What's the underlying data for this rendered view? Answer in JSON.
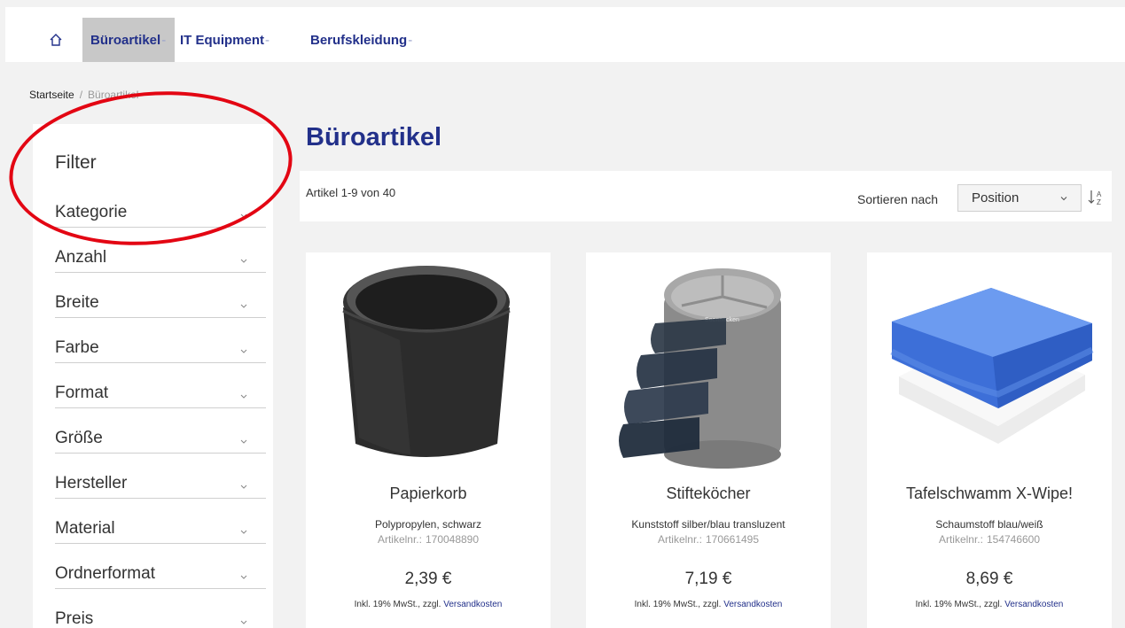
{
  "nav": {
    "home_icon": "home-icon",
    "items": [
      {
        "label": "Büroartikel",
        "dash": "-",
        "active": true
      },
      {
        "label": "IT Equipment",
        "dash": "-"
      },
      {
        "label": "Berufskleidung",
        "dash": "-"
      }
    ]
  },
  "breadcrumb": {
    "home": "Startseite",
    "separator": "/",
    "current": "Büroartikel"
  },
  "filter": {
    "title": "Filter",
    "items": [
      "Kategorie",
      "Anzahl",
      "Breite",
      "Farbe",
      "Format",
      "Größe",
      "Hersteller",
      "Material",
      "Ordnerformat",
      "Preis"
    ]
  },
  "page": {
    "title": "Büroartikel"
  },
  "toolbar": {
    "count": "Artikel 1-9 von 40",
    "sort_label": "Sortieren nach",
    "sort_value": "Position",
    "sort_direction_icon": "sort-ascending-icon"
  },
  "products": [
    {
      "name": "Papierkorb",
      "desc": "Polypropylen, schwarz",
      "sku_label": "Artikelnr.:",
      "sku": "170048890",
      "price": "2,39 €",
      "tax": "Inkl. 19% MwSt., zzgl.",
      "shipping_link": "Versandkosten"
    },
    {
      "name": "Stifteköcher",
      "desc": "Kunststoff silber/blau transluzent",
      "sku_label": "Artikelnr.:",
      "sku": "170661495",
      "price": "7,19 €",
      "tax": "Inkl. 19% MwSt., zzgl.",
      "shipping_link": "Versandkosten",
      "image_brand": "Soennecken"
    },
    {
      "name": "Tafelschwamm X-Wipe!",
      "desc": "Schaumstoff blau/weiß",
      "sku_label": "Artikelnr.:",
      "sku": "154746600",
      "price": "8,69 €",
      "tax": "Inkl. 19% MwSt., zzgl.",
      "shipping_link": "Versandkosten"
    }
  ],
  "colors": {
    "brand": "#22308a",
    "annotation": "#e30613",
    "nav_active_bg": "#c8c8c8",
    "page_bg": "#f2f2f2"
  }
}
